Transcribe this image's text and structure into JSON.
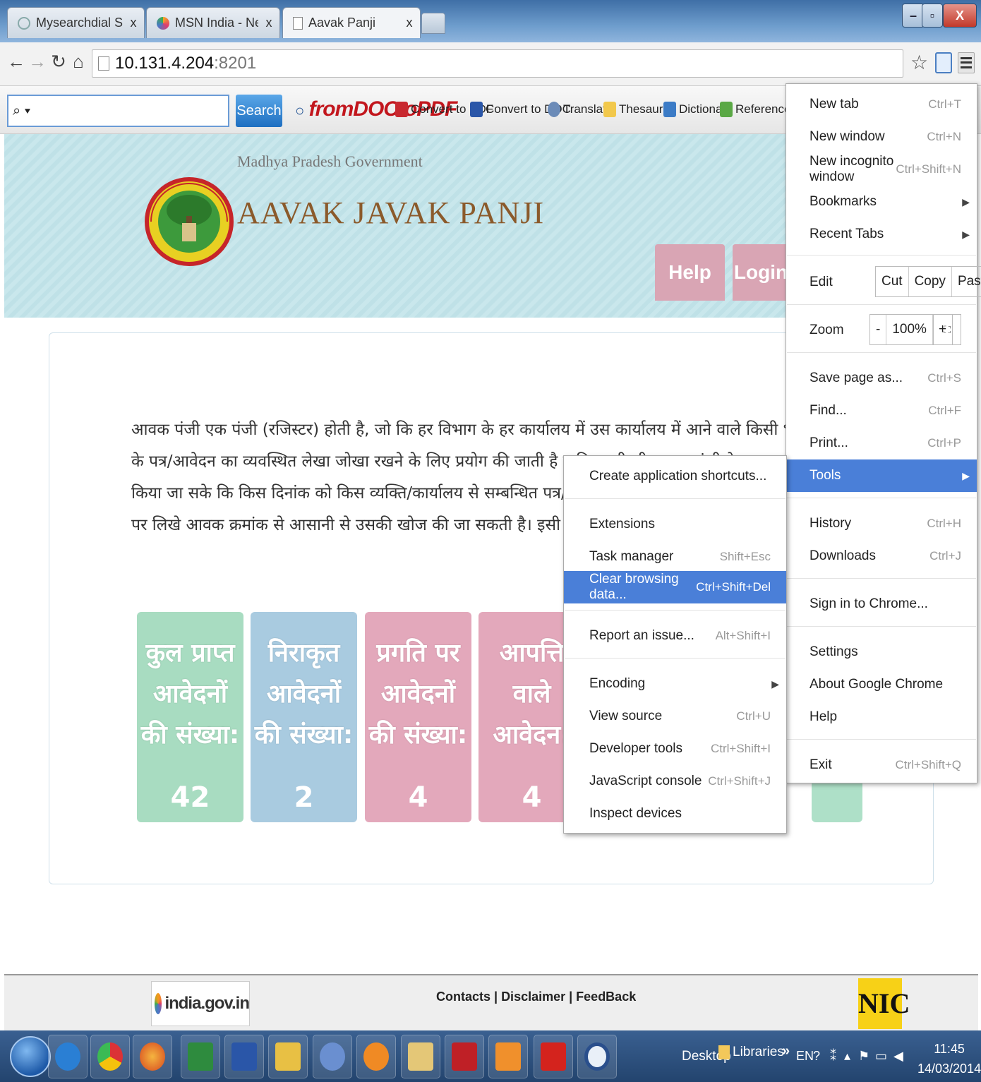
{
  "browser": {
    "tabs": [
      {
        "label": "Mysearchdial Search",
        "close": "x"
      },
      {
        "label": "MSN India - News, Cricket",
        "close": "x"
      },
      {
        "label": "Aavak Panji",
        "close": "x"
      }
    ],
    "window_controls": {
      "minimize": "–",
      "maximize": "▫",
      "close": "X"
    },
    "url_host": "10.131.4.204",
    "url_port": ":8201"
  },
  "search_toolbar": {
    "input_value": "⌕ ▾",
    "search_label": "Search",
    "logo_pre": "○",
    "logo_text": "fromDOCtoPDF",
    "items": [
      "Convert to PDF",
      "Convert to DOC",
      "Translate",
      "Thesaurus",
      "Dictionary",
      "Reference"
    ]
  },
  "site": {
    "gov_name": "Madhya Pradesh Government",
    "title": "AAVAK JAVAK PANJI",
    "help_label": "Help",
    "login_label": "Login"
  },
  "main": {
    "intro": "आवक पंजी एक पंजी (रजिस्टर) होती है, जो कि हर विभाग के हर कार्यालय में उस कार्यालय में आने वाले किसी भी तरह के पत्र/आवेदन का व्यवस्थित लेखा जोखा रखने के लिए प्रयोग की जाती है ताकि कभी भी आवक पंजी देखकर यह पता किया जा सके कि किस दिनांक को किस व्यक्ति/कार्यालय से सम्बन्धित पत्र/आवेदन कार्यालय को प्राप्त हुआ। किसी पत्र पर लिखे आवक क्रमांक से आसानी से उसकी खोज की जा सकती है। इसी प्रकार कार्यालय से जाने वाले पत्र/आवेदन/अन्य डाक के लिए जावक पंजी भी प्रयुक्त की जाती है।",
    "cards": [
      {
        "label": "कुल प्राप्त आवेदनों की संख्या:",
        "value": "42",
        "color": "#a8dcc1"
      },
      {
        "label": "निराकृत आवेदनों की संख्या:",
        "value": "2",
        "color": "#a9cbe0"
      },
      {
        "label": "प्रगति पर आवेदनों की संख्या:",
        "value": "4",
        "color": "#e3a8bb"
      },
      {
        "label": "आपत्ति वाले आवेदन:",
        "value": "4",
        "color": "#e3a8bb"
      }
    ]
  },
  "footer": {
    "india_logo": "india.gov.in",
    "contacts": "Contacts",
    "disclaimer": "Disclaimer",
    "feedback": "FeedBack",
    "separator": " | ",
    "nic": "NIC"
  },
  "chrome_menu": {
    "new_tab": {
      "label": "New tab",
      "shortcut": "Ctrl+T"
    },
    "new_window": {
      "label": "New window",
      "shortcut": "Ctrl+N"
    },
    "incognito": {
      "label": "New incognito window",
      "shortcut": "Ctrl+Shift+N"
    },
    "bookmarks": {
      "label": "Bookmarks"
    },
    "recent_tabs": {
      "label": "Recent Tabs"
    },
    "edit": {
      "label": "Edit",
      "cut": "Cut",
      "copy": "Copy",
      "paste": "Paste"
    },
    "zoom": {
      "label": "Zoom",
      "minus": "-",
      "value": "100%",
      "plus": "+"
    },
    "save_page": {
      "label": "Save page as...",
      "shortcut": "Ctrl+S"
    },
    "find": {
      "label": "Find...",
      "shortcut": "Ctrl+F"
    },
    "print": {
      "label": "Print...",
      "shortcut": "Ctrl+P"
    },
    "tools": {
      "label": "Tools"
    },
    "history": {
      "label": "History",
      "shortcut": "Ctrl+H"
    },
    "downloads": {
      "label": "Downloads",
      "shortcut": "Ctrl+J"
    },
    "sign_in": {
      "label": "Sign in to Chrome..."
    },
    "settings": {
      "label": "Settings"
    },
    "about": {
      "label": "About Google Chrome"
    },
    "help": {
      "label": "Help"
    },
    "exit": {
      "label": "Exit",
      "shortcut": "Ctrl+Shift+Q"
    }
  },
  "tools_menu": {
    "app_shortcuts": {
      "label": "Create application shortcuts..."
    },
    "extensions": {
      "label": "Extensions"
    },
    "task_manager": {
      "label": "Task manager",
      "shortcut": "Shift+Esc"
    },
    "clear_data": {
      "label": "Clear browsing data...",
      "shortcut": "Ctrl+Shift+Del"
    },
    "report_issue": {
      "label": "Report an issue...",
      "shortcut": "Alt+Shift+I"
    },
    "encoding": {
      "label": "Encoding"
    },
    "view_source": {
      "label": "View source",
      "shortcut": "Ctrl+U"
    },
    "dev_tools": {
      "label": "Developer tools",
      "shortcut": "Ctrl+Shift+I"
    },
    "js_console": {
      "label": "JavaScript console",
      "shortcut": "Ctrl+Shift+J"
    },
    "inspect_devices": {
      "label": "Inspect devices"
    }
  },
  "taskbar": {
    "desktop": "Desktop",
    "libraries": "Libraries",
    "chevron": "»",
    "lang": "EN",
    "time": "11:45",
    "date": "14/03/2014"
  }
}
